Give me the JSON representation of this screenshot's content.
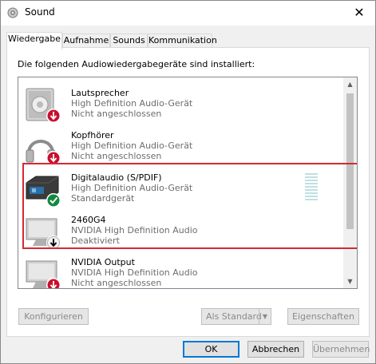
{
  "window": {
    "title": "Sound",
    "close_glyph": "✕"
  },
  "tabs": [
    {
      "label": "Wiedergabe",
      "active": true
    },
    {
      "label": "Aufnahme",
      "active": false
    },
    {
      "label": "Sounds",
      "active": false
    },
    {
      "label": "Kommunikation",
      "active": false
    }
  ],
  "panel": {
    "description": "Die folgenden Audiowiedergabegeräte sind installiert:"
  },
  "devices": [
    {
      "name": "Lautsprecher",
      "driver": "High Definition Audio-Gerät",
      "status": "Nicht angeschlossen",
      "icon": "speaker-icon",
      "badge": "disconnected-badge"
    },
    {
      "name": "Kopfhörer",
      "driver": "High Definition Audio-Gerät",
      "status": "Nicht angeschlossen",
      "icon": "headphones-icon",
      "badge": "disconnected-badge"
    },
    {
      "name": "Digitalaudio (S/PDIF)",
      "driver": "High Definition Audio-Gerät",
      "status": "Standardgerät",
      "icon": "digital-audio-icon",
      "badge": "default-check-badge"
    },
    {
      "name": "2460G4",
      "driver": "NVIDIA High Definition Audio",
      "status": "Deaktiviert",
      "icon": "monitor-icon",
      "badge": "disabled-badge"
    },
    {
      "name": "NVIDIA Output",
      "driver": "NVIDIA High Definition Audio",
      "status": "Nicht angeschlossen",
      "icon": "monitor-icon",
      "badge": "disconnected-badge"
    }
  ],
  "buttons": {
    "configure": "Konfigurieren",
    "set_default": "Als Standard",
    "properties": "Eigenschaften",
    "ok": "OK",
    "cancel": "Abbrechen",
    "apply": "Übernehmen"
  },
  "colors": {
    "highlight_border": "#d42a33",
    "disconnected_badge": "#c8102e",
    "default_badge": "#10893e",
    "level_meter": "#bfe0e2",
    "accent": "#0078d7"
  }
}
